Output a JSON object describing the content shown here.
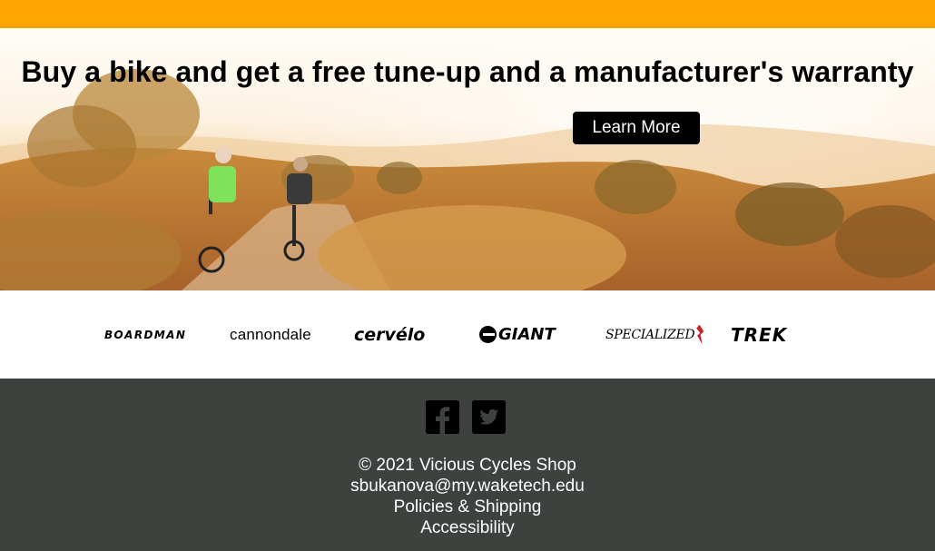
{
  "colors": {
    "top_bar": "#ffa500",
    "footer_bg": "#3e423f",
    "button_bg": "#000000",
    "text_light": "#ffffff"
  },
  "hero": {
    "heading": "Buy a bike and get a free tune-up and a manufacturer's warranty",
    "button_label": "Learn More"
  },
  "brands": [
    "BOARDMAN",
    "cannondale",
    "cervélo",
    "GIANT",
    "SPECIALIZED",
    "TREK"
  ],
  "social": {
    "icons": [
      "facebook-icon",
      "twitter-icon"
    ]
  },
  "footer": {
    "copyright": "© 2021 Vicious Cycles Shop",
    "email": "sbukanova@my.waketech.edu",
    "policies_link": "Policies & Shipping",
    "accessibility_link": "Accessibility"
  }
}
